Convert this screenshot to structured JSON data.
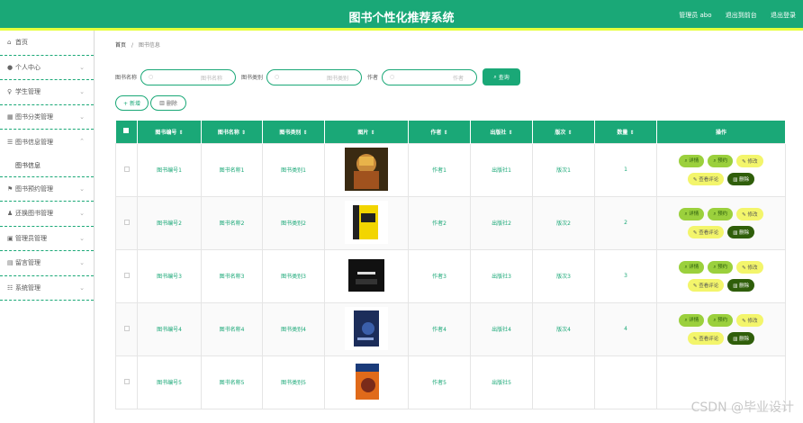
{
  "header": {
    "title": "图书个性化推荐系统",
    "user": "管理员 abo",
    "back_label": "退出到前台",
    "logout_label": "退出登录"
  },
  "sidebar": {
    "items": [
      {
        "label": "首页",
        "icon": "home-icon"
      },
      {
        "label": "个人中心",
        "icon": "user-icon"
      },
      {
        "label": "学生管理",
        "icon": "student-icon"
      },
      {
        "label": "图书分类管理",
        "icon": "category-icon"
      },
      {
        "label": "图书信息管理",
        "icon": "list-icon"
      },
      {
        "label": "图书信息",
        "sub": true
      },
      {
        "label": "图书预约管理",
        "icon": "flag-icon"
      },
      {
        "label": "还换图书管理",
        "icon": "exchange-icon"
      },
      {
        "label": "管理员管理",
        "icon": "admin-icon"
      },
      {
        "label": "留言管理",
        "icon": "message-icon"
      },
      {
        "label": "系统管理",
        "icon": "settings-icon"
      }
    ]
  },
  "breadcrumb": {
    "home": "首页",
    "sep": "/",
    "current": "图书信息"
  },
  "search": {
    "name_label": "图书名称",
    "name_placeholder": "图书名称",
    "type_label": "图书类别",
    "type_placeholder": "图书类别",
    "author_label": "作者",
    "author_placeholder": "作者",
    "button": "查询"
  },
  "actions": {
    "add": "+ 新增",
    "delete": "删除"
  },
  "table": {
    "headers": [
      "图书编号",
      "图书名称",
      "图书类别",
      "图片",
      "作者",
      "出版社",
      "版次",
      "数量",
      "操作"
    ],
    "rows": [
      {
        "no": "图书编号1",
        "name": "图书名称1",
        "type": "图书类别1",
        "author": "作者1",
        "publisher": "出版社1",
        "edition": "版次1",
        "qty": "1"
      },
      {
        "no": "图书编号2",
        "name": "图书名称2",
        "type": "图书类别2",
        "author": "作者2",
        "publisher": "出版社2",
        "edition": "版次2",
        "qty": "2"
      },
      {
        "no": "图书编号3",
        "name": "图书名称3",
        "type": "图书类别3",
        "author": "作者3",
        "publisher": "出版社3",
        "edition": "版次3",
        "qty": "3"
      },
      {
        "no": "图书编号4",
        "name": "图书名称4",
        "type": "图书类别4",
        "author": "作者4",
        "publisher": "出版社4",
        "edition": "版次4",
        "qty": "4"
      },
      {
        "no": "图书编号5",
        "name": "图书名称5",
        "type": "图书类别5",
        "author": "作者5",
        "publisher": "出版社5",
        "edition": "",
        "qty": ""
      }
    ],
    "ops": {
      "detail": "详情",
      "reserve": "预约",
      "edit": "修改",
      "review": "查看评论",
      "delete": "删除"
    }
  },
  "watermark": "CSDN @毕业设计",
  "colors": {
    "primary": "#1aa877",
    "accent_bar": "#e6ff3c"
  }
}
